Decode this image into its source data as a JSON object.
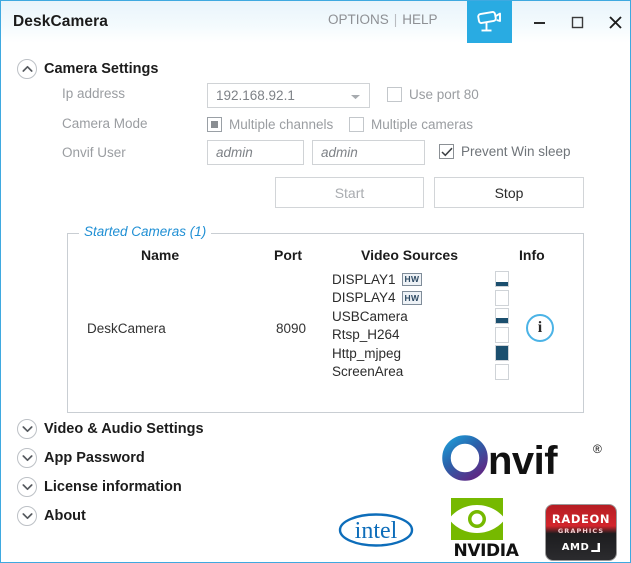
{
  "window": {
    "title": "DeskCamera",
    "links": [
      {
        "label": "OPTIONS",
        "name": "options-link"
      },
      {
        "label": "|",
        "name": "link-separator"
      },
      {
        "label": "HELP",
        "name": "help-link"
      }
    ],
    "accent_color": "#29abe2",
    "controls": {
      "minimize": "minimize-button",
      "maximize": "maximize-button",
      "close": "close-button"
    }
  },
  "camera_settings": {
    "header": "Camera Settings",
    "expanded": true,
    "ip_address": {
      "label": "Ip address",
      "value": "192.168.92.1"
    },
    "use_port_80": {
      "label": "Use port 80",
      "checked": false
    },
    "camera_mode": {
      "label": "Camera Mode",
      "options": [
        {
          "label": "Multiple channels",
          "selected": true
        },
        {
          "label": "Multiple cameras",
          "selected": false
        }
      ]
    },
    "onvif_user": {
      "label": "Onvif User",
      "user_value": "admin",
      "password_value": "admin"
    },
    "prevent_win_sleep": {
      "label": "Prevent Win sleep",
      "checked": true
    },
    "buttons": {
      "start": {
        "label": "Start",
        "enabled": false
      },
      "stop": {
        "label": "Stop",
        "enabled": true
      }
    }
  },
  "started_cameras": {
    "legend": "Started Cameras (1)",
    "count": 1,
    "columns": [
      "Name",
      "Port",
      "Video Sources",
      "Info"
    ],
    "rows": [
      {
        "name": "DeskCamera",
        "port": "8090",
        "info_label": "i",
        "sources": [
          {
            "label": "DISPLAY1",
            "badge": "HW",
            "level": 34
          },
          {
            "label": "DISPLAY4",
            "badge": "HW",
            "level": 0
          },
          {
            "label": "USBCamera",
            "badge": "",
            "level": 38
          },
          {
            "label": "Rtsp_H264",
            "badge": "",
            "level": 0
          },
          {
            "label": "Http_mjpeg",
            "badge": "",
            "level": 100
          },
          {
            "label": "ScreenArea",
            "badge": "",
            "level": 0
          }
        ]
      }
    ]
  },
  "collapsed_sections": [
    {
      "label": "Video & Audio Settings",
      "name": "section-video-audio-settings"
    },
    {
      "label": "App Password",
      "name": "section-app-password"
    },
    {
      "label": "License information",
      "name": "section-license-information"
    },
    {
      "label": "About",
      "name": "section-about"
    }
  ],
  "logos": {
    "onvif": {
      "text": "nvif",
      "registered": "®"
    },
    "intel": {
      "text": "intel"
    },
    "nvidia": {
      "text": "NVIDIA"
    },
    "radeon": {
      "line1": "RADEON",
      "line2": "GRAPHICS",
      "line3": "AMD"
    }
  }
}
